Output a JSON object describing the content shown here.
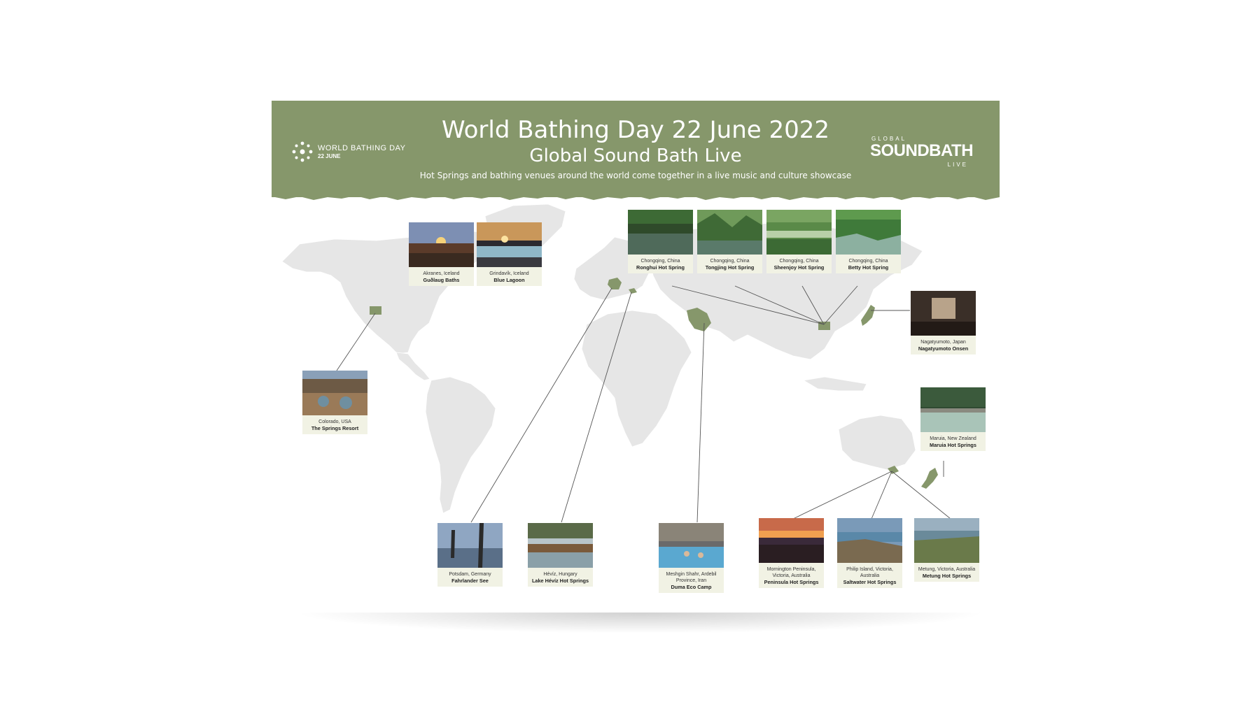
{
  "header": {
    "title": "World Bathing Day 22 June 2022",
    "subtitle": "Global Sound Bath Live",
    "description": "Hot Springs and bathing venues around the world come together in a live music and culture showcase",
    "left_logo": {
      "line1": "WORLD BATHING DAY",
      "line2": "22 JUNE",
      "icon": "sun-burst-icon"
    },
    "right_logo": {
      "line1": "GLOBAL",
      "line2": "SOUNDBATH",
      "line3": "LIVE"
    }
  },
  "colors": {
    "brand_green": "#86976b",
    "map_land": "#e5e5e5",
    "highlight_land": "#86976b",
    "card_bg": "#f1f2e4",
    "leader_line": "#555555"
  },
  "venues": [
    {
      "location": "Akranes, Iceland",
      "name": "Guðlaug Baths"
    },
    {
      "location": "Grindavík, Iceland",
      "name": "Blue Lagoon"
    },
    {
      "location": "Chongqing, China",
      "name": "Ronghui Hot Spring"
    },
    {
      "location": "Chongqing, China",
      "name": "Tongjing Hot Spring"
    },
    {
      "location": "Chongqing, China",
      "name": "Sheenjoy Hot Spring"
    },
    {
      "location": "Chongqing, China",
      "name": "Betty Hot Spring"
    },
    {
      "location": "Nagatyumoto, Japan",
      "name": "Nagatyumoto Onsen"
    },
    {
      "location": "Colorado, USA",
      "name": "The Springs Resort"
    },
    {
      "location": "Maruia, New Zealand",
      "name": "Maruia Hot Springs"
    },
    {
      "location": "Potsdam, Germany",
      "name": "Fahrlander See"
    },
    {
      "location": "Hévíz, Hungary",
      "name": "Lake Hévíz Hot Springs"
    },
    {
      "location": "Meshgin Shahr, Ardebil Province, Iran",
      "name": "Duma Eco Camp"
    },
    {
      "location": "Mornington Peninsula, Victoria, Australia",
      "name": "Peninsula Hot Springs"
    },
    {
      "location": "Philip Island, Victoria, Australia",
      "name": "Saltwater Hot Springs"
    },
    {
      "location": "Metung, Victoria, Australia",
      "name": "Metung Hot Springs"
    }
  ]
}
